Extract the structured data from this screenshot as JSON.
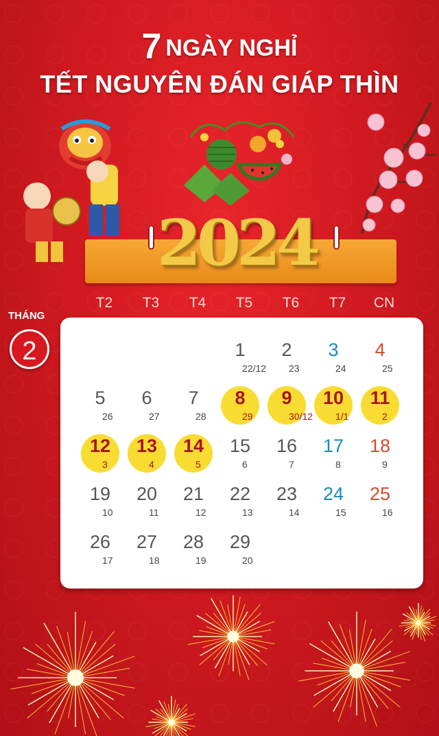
{
  "title": {
    "number": "7",
    "line1": "NGÀY NGHỈ",
    "line2": "TẾT NGUYÊN ĐÁN GIÁP THÌN"
  },
  "year": "2024",
  "calendar": {
    "month_label": "THÁNG",
    "month_number": "2",
    "weekdays": [
      "T2",
      "T3",
      "T4",
      "T5",
      "T6",
      "T7",
      "CN"
    ],
    "weeks": [
      [
        null,
        null,
        null,
        {
          "day": "1",
          "lunar": "22/12"
        },
        {
          "day": "2",
          "lunar": "23"
        },
        {
          "day": "3",
          "lunar": "24"
        },
        {
          "day": "4",
          "lunar": "25"
        }
      ],
      [
        {
          "day": "5",
          "lunar": "26"
        },
        {
          "day": "6",
          "lunar": "27"
        },
        {
          "day": "7",
          "lunar": "28"
        },
        {
          "day": "8",
          "lunar": "29",
          "holiday": true
        },
        {
          "day": "9",
          "lunar": "30/12",
          "holiday": true
        },
        {
          "day": "10",
          "lunar": "1/1",
          "holiday": true
        },
        {
          "day": "11",
          "lunar": "2",
          "holiday": true
        }
      ],
      [
        {
          "day": "12",
          "lunar": "3",
          "holiday": true
        },
        {
          "day": "13",
          "lunar": "4",
          "holiday": true
        },
        {
          "day": "14",
          "lunar": "5",
          "holiday": true
        },
        {
          "day": "15",
          "lunar": "6"
        },
        {
          "day": "16",
          "lunar": "7"
        },
        {
          "day": "17",
          "lunar": "8"
        },
        {
          "day": "18",
          "lunar": "9"
        }
      ],
      [
        {
          "day": "19",
          "lunar": "10"
        },
        {
          "day": "20",
          "lunar": "11"
        },
        {
          "day": "21",
          "lunar": "12"
        },
        {
          "day": "22",
          "lunar": "13"
        },
        {
          "day": "23",
          "lunar": "14"
        },
        {
          "day": "24",
          "lunar": "15"
        },
        {
          "day": "25",
          "lunar": "16"
        }
      ],
      [
        {
          "day": "26",
          "lunar": "17"
        },
        {
          "day": "27",
          "lunar": "18"
        },
        {
          "day": "28",
          "lunar": "19"
        },
        {
          "day": "29",
          "lunar": "20"
        },
        null,
        null,
        null
      ]
    ]
  },
  "colors": {
    "background": "#d11a20",
    "holiday_highlight": "#f8dc32",
    "holiday_text": "#a8151c",
    "saturday": "#1a8bc0",
    "sunday": "#d94a2c",
    "banner": "#f09a26",
    "year_gold": "#f3c948"
  },
  "decorations": {
    "left": "lion-dance-children-illustration",
    "center": "banh-chung-and-watermelon-fruit-tray",
    "right": "peach-blossom-branch",
    "bottom": "fireworks"
  }
}
